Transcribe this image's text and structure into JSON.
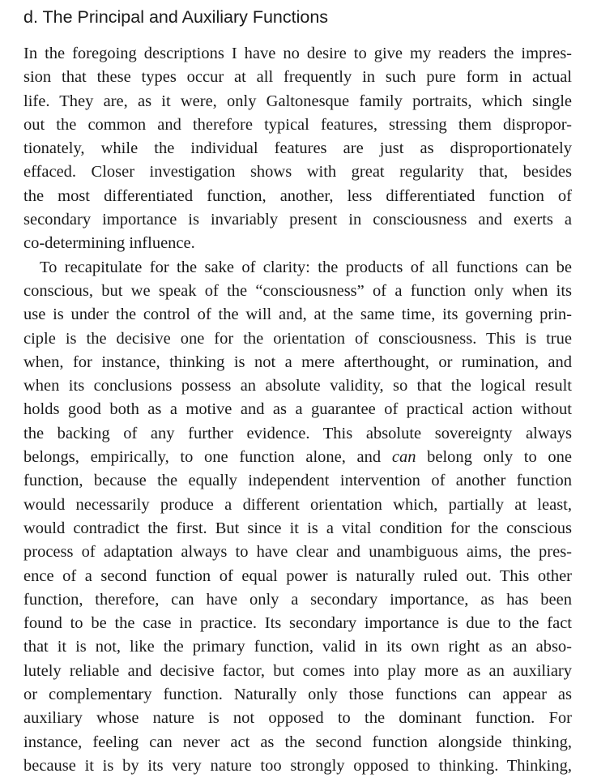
{
  "section": {
    "heading": "d. The Principal and Auxiliary Functions"
  },
  "paragraphs": [
    {
      "lines": [
        "In the foregoing descriptions I have no desire to give my readers the impres-",
        "sion that these types occur at all frequently in such pure form in actual",
        "life. They are, as it were, only Galtonesque family portraits, which single",
        "out the common and therefore typical features, stressing them dispropor-",
        "tionately, while the individual features are just as disproportionately",
        "effaced. Closer investigation shows with great regularity that, besides",
        "the most differentiated function, another, less differentiated function of",
        "secondary importance is invariably present in consciousness and exerts a",
        "co-determining influence."
      ]
    },
    {
      "lines": [
        "To recapitulate for the sake of clarity: the products of all functions can be",
        "conscious, but we speak of the “consciousness” of a function only when its",
        "use is under the control of the will and, at the same time, its governing prin-",
        "ciple is the decisive one for the orientation of consciousness. This is true",
        "when, for instance, thinking is not a mere afterthought, or rumination, and",
        "when its conclusions possess an absolute validity, so that the logical result",
        "holds good both as a motive and as a guarantee of practical action without",
        "the backing of any further evidence. This absolute sovereignty always",
        "function, because the equally independent intervention of another function",
        "would necessarily produce a different orientation which, partially at least,",
        "would contradict the first. But since it is a vital condition for the conscious",
        "process of adaptation always to have clear and unambiguous aims, the pres-",
        "ence of a second function of equal power is naturally ruled out. This other",
        "function, therefore, can have only a secondary importance, as has been",
        "found to be the case in practice. Its secondary importance is due to the fact",
        "that it is not, like the primary function, valid in its own right as an abso-",
        "lutely reliable and decisive factor, but comes into play more as an auxiliary",
        "or complementary function. Naturally only those functions can appear as",
        "auxiliary whose nature is not opposed to the dominant function. For",
        "instance, feeling can never act as the second function alongside thinking,",
        "because it is by its very nature too strongly opposed to thinking. Thinking,"
      ],
      "italic_line": {
        "before": "belongs, empirically, to one function alone, and",
        "italic": "can",
        "after": "belong only to one"
      }
    }
  ]
}
